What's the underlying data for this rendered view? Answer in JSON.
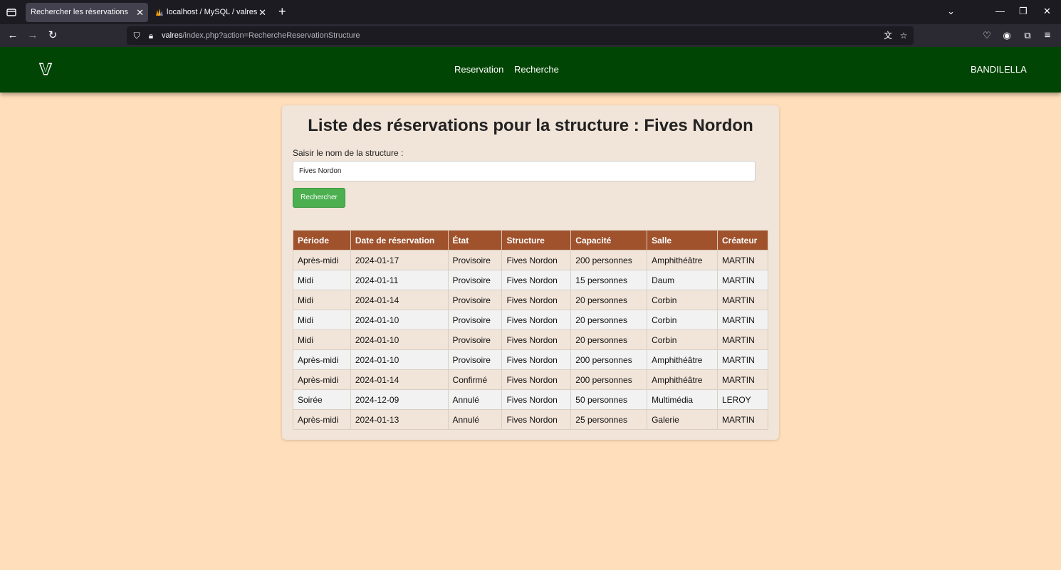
{
  "browser": {
    "tabs": [
      {
        "label": "Rechercher les réservations",
        "active": true
      },
      {
        "label": "localhost / MySQL / valres / uti",
        "active": false
      }
    ],
    "url": {
      "host": "valres",
      "path": "/index.php?action=RechercheReservationStructure"
    }
  },
  "site": {
    "logo_letter": "V",
    "menu": [
      "Reservation",
      "Recherche"
    ],
    "user": "BANDILELLA",
    "header_color": "#004503"
  },
  "main": {
    "title": "Liste des réservations pour la structure : Fives Nordon",
    "search": {
      "label": "Saisir le nom de la structure :",
      "value": "Fives Nordon",
      "button": "Rechercher"
    },
    "table": {
      "headers": [
        "Période",
        "Date de réservation",
        "État",
        "Structure",
        "Capacité",
        "Salle",
        "Créateur"
      ],
      "rows": [
        [
          "Après-midi",
          "2024-01-17",
          "Provisoire",
          "Fives Nordon",
          "200 personnes",
          "Amphithéâtre",
          "MARTIN"
        ],
        [
          "Midi",
          "2024-01-11",
          "Provisoire",
          "Fives Nordon",
          "15 personnes",
          "Daum",
          "MARTIN"
        ],
        [
          "Midi",
          "2024-01-14",
          "Provisoire",
          "Fives Nordon",
          "20 personnes",
          "Corbin",
          "MARTIN"
        ],
        [
          "Midi",
          "2024-01-10",
          "Provisoire",
          "Fives Nordon",
          "20 personnes",
          "Corbin",
          "MARTIN"
        ],
        [
          "Midi",
          "2024-01-10",
          "Provisoire",
          "Fives Nordon",
          "20 personnes",
          "Corbin",
          "MARTIN"
        ],
        [
          "Après-midi",
          "2024-01-10",
          "Provisoire",
          "Fives Nordon",
          "200 personnes",
          "Amphithéâtre",
          "MARTIN"
        ],
        [
          "Après-midi",
          "2024-01-14",
          "Confirmé",
          "Fives Nordon",
          "200 personnes",
          "Amphithéâtre",
          "MARTIN"
        ],
        [
          "Soirée",
          "2024-12-09",
          "Annulé",
          "Fives Nordon",
          "50 personnes",
          "Multimédia",
          "LEROY"
        ],
        [
          "Après-midi",
          "2024-01-13",
          "Annulé",
          "Fives Nordon",
          "25 personnes",
          "Galerie",
          "MARTIN"
        ]
      ]
    }
  }
}
